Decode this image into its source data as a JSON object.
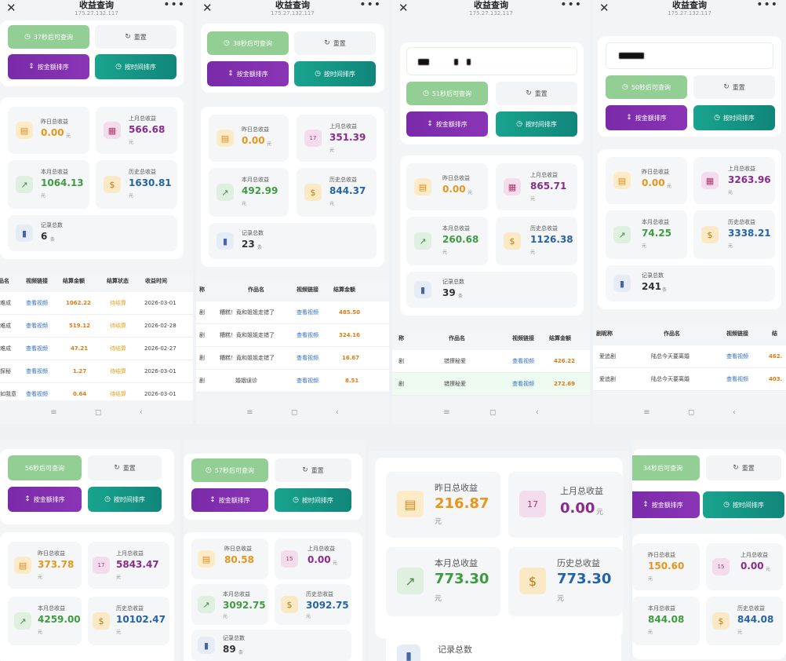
{
  "app": {
    "title": "收益查询",
    "ip": "175.27.132.117"
  },
  "icons": {
    "close": "close-icon",
    "more": "more-icon",
    "clock": "clock-icon",
    "refresh": "refresh-icon",
    "sort": "sort-icon",
    "sun": "sunset-icon",
    "calendar": "calendar-icon",
    "chart": "line-chart-icon",
    "bag": "money-bag-icon",
    "bar": "bar-chart-icon"
  },
  "labels": {
    "reset": "重置",
    "sort_amount": "按金额排序",
    "sort_time": "按时间排序",
    "yesterday": "昨日总收益",
    "last_month": "上月总收益",
    "this_month": "本月总收益",
    "history": "历史总收益",
    "records": "记录总数",
    "unit_yuan": "元",
    "unit_count": "条"
  },
  "panels": [
    {
      "wait": "37秒后可查询",
      "yesterday": "0.00",
      "last_month": "566.68",
      "this_month": "1064.13",
      "history": "1630.81",
      "records": "6"
    },
    {
      "wait": "38秒后可查询",
      "yesterday": "0.00",
      "last_month": "351.39",
      "this_month": "492.99",
      "history": "844.37",
      "records": "23"
    },
    {
      "wait": "51秒后可查询",
      "yesterday": "0.00",
      "last_month": "865.71",
      "this_month": "260.68",
      "history": "1126.38",
      "records": "39"
    },
    {
      "wait": "50秒后可查询",
      "yesterday": "0.00",
      "last_month": "3263.96",
      "this_month": "74.25",
      "history": "3338.21",
      "records": "241"
    },
    {
      "wait": "56秒后可查询",
      "yesterday": "373.78",
      "last_month": "5843.47",
      "this_month": "4259.00",
      "history": "10102.47"
    },
    {
      "wait": "57秒后可查询",
      "yesterday": "80.58",
      "last_month": "0.00",
      "this_month": "3092.75",
      "history": "3092.75",
      "records": "89"
    },
    {
      "yesterday": "216.87",
      "last_month": "0.00",
      "this_month": "773.30",
      "history": "773.30"
    },
    {
      "wait": "34秒后可查询",
      "yesterday": "150.60",
      "last_month": "0.00",
      "this_month": "844.08",
      "history": "844.08"
    }
  ],
  "calendar_days": {
    "p2": "17",
    "p5": "17",
    "p6": "15",
    "p7": "17",
    "p8": "15"
  },
  "table1": {
    "headers": [
      "品名",
      "视频链接",
      "结算金额",
      "结算状态",
      "收益时间"
    ],
    "rows": [
      [
        "难成",
        "查看视频",
        "1062.22",
        "待结算",
        "2026-03-01"
      ],
      [
        "难成",
        "查看视频",
        "519.12",
        "待结算",
        "2026-02-28"
      ],
      [
        "难成",
        "查看视频",
        "47.21",
        "待结算",
        "2026-02-27"
      ],
      [
        "探秘",
        "查看视频",
        "1.27",
        "待结算",
        "2026-03-01"
      ],
      [
        "如我意",
        "查看视频",
        "0.64",
        "待结算",
        "2026-03-01"
      ]
    ]
  },
  "table2": {
    "headers": [
      "称",
      "作品名",
      "视频链接",
      "结算金额"
    ],
    "rows": [
      [
        "剧",
        "糟糕！竟和姐姐走错了",
        "查看视频",
        "485.50"
      ],
      [
        "剧",
        "糟糕！竟和姐姐走错了",
        "查看视频",
        "324.16"
      ],
      [
        "剧",
        "糟糕！竟和姐姐走错了",
        "查看视频",
        "16.67"
      ],
      [
        "剧",
        "婚姻误诊",
        "查看视频",
        "8.51"
      ]
    ]
  },
  "table3": {
    "headers": [
      "称",
      "作品名",
      "视频链接",
      "结算金额"
    ],
    "rows": [
      [
        "剧",
        "错撩秘爱",
        "查看视频",
        "426.22"
      ],
      [
        "剧",
        "错撩秘爱",
        "查看视频",
        "272.69"
      ]
    ]
  },
  "table4": {
    "headers": [
      "剧昵称",
      "作品名",
      "视频链接",
      "结"
    ],
    "rows": [
      [
        "爱追剧",
        "陆总今天要离婚",
        "查看视频",
        "462."
      ],
      [
        "爱追剧",
        "陆总今天要离婚",
        "查看视频",
        "403."
      ]
    ]
  },
  "nav": {
    "menu": "≡",
    "home": "◻",
    "back": "‹"
  }
}
